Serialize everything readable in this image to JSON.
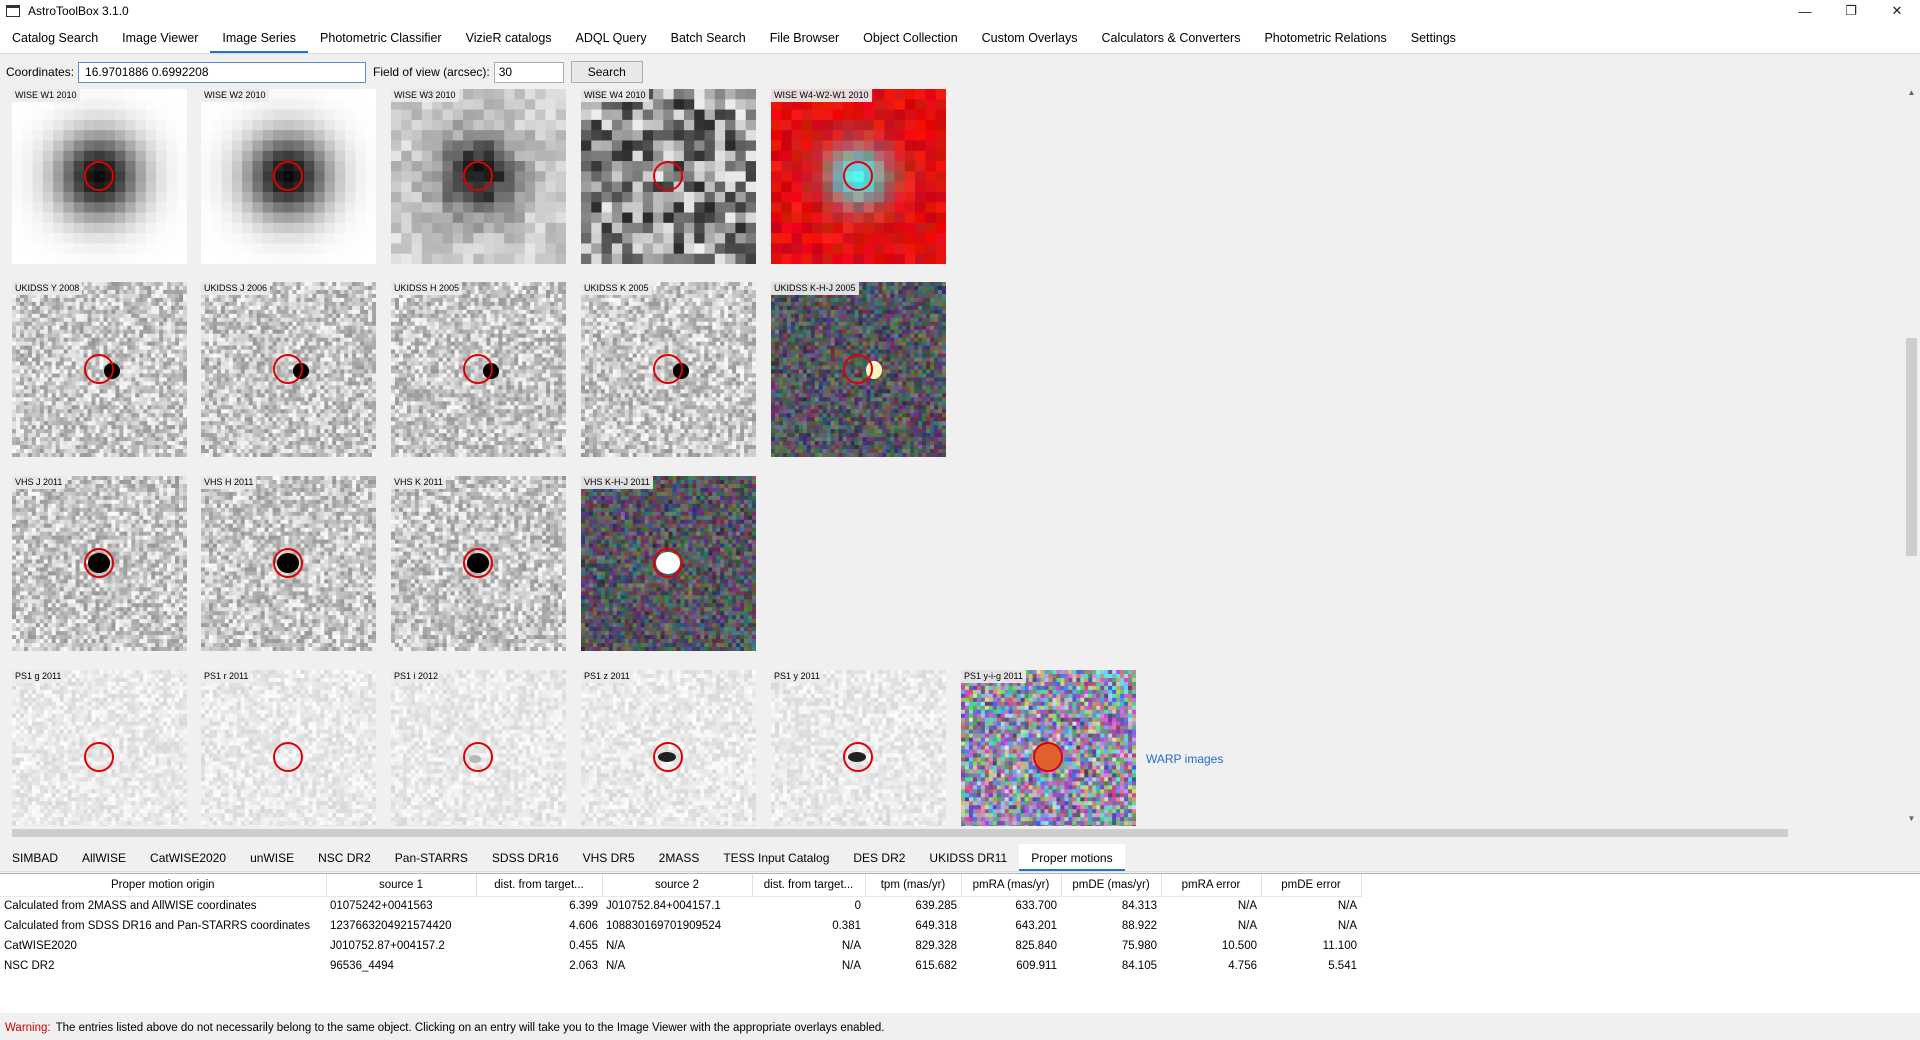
{
  "window": {
    "title": "AstroToolBox 3.1.0",
    "minimize": "—",
    "restore": "❐",
    "close": "✕"
  },
  "menu_tabs": [
    {
      "label": "Catalog Search"
    },
    {
      "label": "Image Viewer"
    },
    {
      "label": "Image Series",
      "active": true
    },
    {
      "label": "Photometric Classifier"
    },
    {
      "label": "VizieR catalogs"
    },
    {
      "label": "ADQL Query"
    },
    {
      "label": "Batch Search"
    },
    {
      "label": "File Browser"
    },
    {
      "label": "Object Collection"
    },
    {
      "label": "Custom Overlays"
    },
    {
      "label": "Calculators & Converters"
    },
    {
      "label": "Photometric Relations"
    },
    {
      "label": "Settings"
    }
  ],
  "search": {
    "coord_label": "Coordinates:",
    "coord_value": "16.9701886 0.6992208",
    "fov_label": "Field of view (arcsec):",
    "fov_value": "30",
    "button": "Search"
  },
  "images": [
    {
      "label": "WISE W1 2010",
      "kind": "wise1"
    },
    {
      "label": "WISE W2 2010",
      "kind": "wise1"
    },
    {
      "label": "WISE W3 2010",
      "kind": "wise3"
    },
    {
      "label": "WISE W4 2010",
      "kind": "wise4"
    },
    {
      "label": "WISE W4-W2-W1 2010",
      "kind": "wisecolor"
    },
    {
      "label": "UKIDSS Y 2008",
      "kind": "noise"
    },
    {
      "label": "UKIDSS J 2006",
      "kind": "noise"
    },
    {
      "label": "UKIDSS H 2005",
      "kind": "noise"
    },
    {
      "label": "UKIDSS K 2005",
      "kind": "noise"
    },
    {
      "label": "UKIDSS K-H-J 2005",
      "kind": "colornoise"
    },
    {
      "label": "VHS J 2011",
      "kind": "noise"
    },
    {
      "label": "VHS H 2011",
      "kind": "noise"
    },
    {
      "label": "VHS K 2011",
      "kind": "noise"
    },
    {
      "label": "VHS K-H-J 2011",
      "kind": "colornoise"
    },
    {
      "label": "PS1 g 2011",
      "kind": "faint"
    },
    {
      "label": "PS1 r 2011",
      "kind": "faint"
    },
    {
      "label": "PS1 i 2012",
      "kind": "faint"
    },
    {
      "label": "PS1 z 2011",
      "kind": "faint"
    },
    {
      "label": "PS1 y 2011",
      "kind": "faint"
    },
    {
      "label": "PS1 y-i-g 2011",
      "kind": "colorps1"
    }
  ],
  "warp_link": "WARP images",
  "bottom_tabs": [
    {
      "label": "SIMBAD"
    },
    {
      "label": "AllWISE"
    },
    {
      "label": "CatWISE2020"
    },
    {
      "label": "unWISE"
    },
    {
      "label": "NSC DR2"
    },
    {
      "label": "Pan-STARRS"
    },
    {
      "label": "SDSS DR16"
    },
    {
      "label": "VHS DR5"
    },
    {
      "label": "2MASS"
    },
    {
      "label": "TESS Input Catalog"
    },
    {
      "label": "DES DR2"
    },
    {
      "label": "UKIDSS DR11"
    },
    {
      "label": "Proper motions",
      "active": true
    }
  ],
  "table": {
    "columns": [
      "Proper motion origin",
      "source 1",
      "dist. from target...",
      "source 2",
      "dist. from target...",
      "tpm (mas/yr)",
      "pmRA (mas/yr)",
      "pmDE (mas/yr)",
      "pmRA error",
      "pmDE error"
    ],
    "rows": [
      [
        "Calculated from 2MASS and AllWISE coordinates",
        "01075242+0041563",
        "6.399",
        "J010752.84+004157.1",
        "0",
        "639.285",
        "633.700",
        "84.313",
        "N/A",
        "N/A"
      ],
      [
        "Calculated from SDSS DR16 and Pan-STARRS coordinates",
        "1237663204921574420",
        "4.606",
        "108830169701909524",
        "0.381",
        "649.318",
        "643.201",
        "88.922",
        "N/A",
        "N/A"
      ],
      [
        "CatWISE2020",
        "J010752.87+004157.2",
        "0.455",
        "N/A",
        "N/A",
        "829.328",
        "825.840",
        "75.980",
        "10.500",
        "11.100"
      ],
      [
        "NSC DR2",
        "96536_4494",
        "2.063",
        "N/A",
        "N/A",
        "615.682",
        "609.911",
        "84.105",
        "4.756",
        "5.541"
      ]
    ]
  },
  "status": {
    "warning": "Warning:",
    "message": "The entries listed above do not necessarily belong to the same object. Clicking on an entry will take you to the Image Viewer with the appropriate overlays enabled."
  },
  "colors": {
    "accent": "#1a73d9",
    "circle": "#e00000",
    "warning": "#d10000",
    "link": "#1c6fd1"
  }
}
